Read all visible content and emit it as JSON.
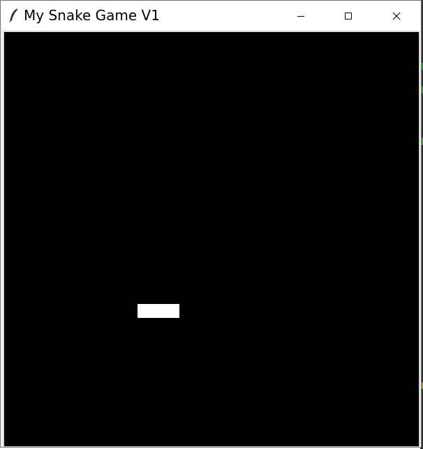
{
  "window": {
    "title": "My Snake Game V1",
    "app_icon": "feather-icon",
    "controls": {
      "minimize_icon": "minimize-icon",
      "maximize_icon": "maximize-icon",
      "close_icon": "close-icon"
    }
  },
  "game": {
    "background_color": "#000000",
    "snake_color": "#ffffff",
    "snake_segments": 3
  }
}
